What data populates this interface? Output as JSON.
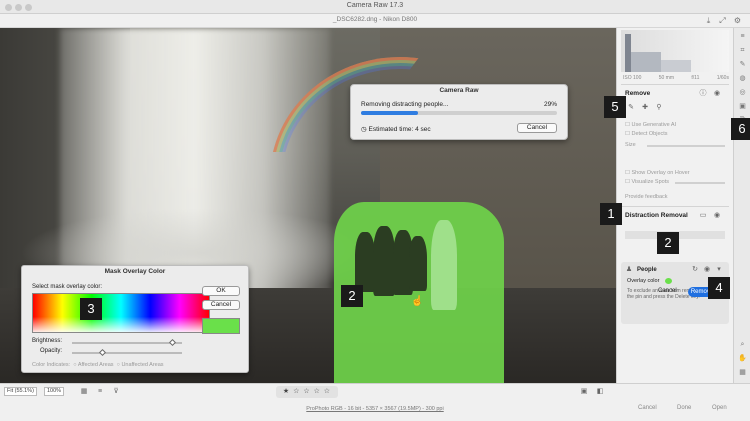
{
  "window": {
    "title": "Camera Raw 17.3",
    "file_title": "_DSC6282.dng  -  Nikon D800"
  },
  "progress_dialog": {
    "title": "Camera Raw",
    "message": "Removing distracting people...",
    "percent_label": "29%",
    "progress": 0.29,
    "time_label": "Estimated time: 4 sec",
    "cancel_label": "Cancel"
  },
  "mask_dialog": {
    "title": "Mask Overlay Color",
    "select_label": "Select mask overlay color:",
    "ok_label": "OK",
    "cancel_label": "Cancel",
    "brightness_label": "Brightness:",
    "opacity_label": "Opacity:",
    "brightness_value": 0.92,
    "opacity_value": 0.28,
    "color_indicates_label": "Color Indicates:",
    "affected_label": "Affected Areas",
    "unaffected_label": "Unaffected Areas",
    "swatch_color": "#6ae04a"
  },
  "panel": {
    "histo_info": [
      "ISO 100",
      "50 mm",
      "f/11",
      "1/60s"
    ],
    "remove_title": "Remove",
    "use_gen_ai": "Use Generative AI",
    "detect_objects": "Detect Objects",
    "size_label": "Size",
    "show_overlay": "Show Overlay on Hover",
    "visualize_spots": "Visualize Spots",
    "feedback": "Provide feedback",
    "distraction_title": "Distraction Removal",
    "people_label": "People",
    "overlay_color_label": "Overlay color",
    "hint": "To exclude an area from removal, click on the pin and press the Delete key.",
    "cancel_label": "Cancel",
    "remove_label": "Remove"
  },
  "bottom": {
    "fit_label": "Fit (55.1%)",
    "zoom_label": "100%",
    "stars": "★ ☆ ☆ ☆ ☆",
    "file_info": "ProPhoto RGB - 16 bit - 5357 × 3567 (19.5MP) - 300 ppi",
    "cancel": "Cancel",
    "done": "Done",
    "open": "Open"
  },
  "callouts": [
    "1",
    "2",
    "3",
    "2",
    "4",
    "5",
    "6"
  ],
  "colors": {
    "accent": "#1f6fe0",
    "mask": "#6fd24a"
  }
}
